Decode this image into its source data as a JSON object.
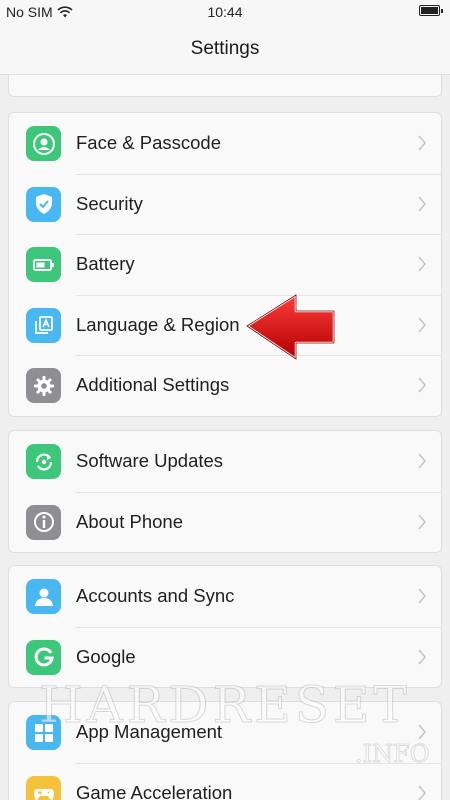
{
  "status_bar": {
    "carrier": "No SIM",
    "time": "10:44"
  },
  "header": {
    "title": "Settings"
  },
  "groups": [
    {
      "items": [
        {
          "label": "Face & Passcode",
          "icon": "face-passcode-icon",
          "color": "#3dc77a"
        },
        {
          "label": "Security",
          "icon": "shield-icon",
          "color": "#4ab8f0"
        },
        {
          "label": "Battery",
          "icon": "battery-icon",
          "color": "#3dc77a"
        },
        {
          "label": "Language & Region",
          "icon": "language-icon",
          "color": "#4ab8f0"
        },
        {
          "label": "Additional Settings",
          "icon": "gear-icon",
          "color": "#8e8e93"
        }
      ]
    },
    {
      "items": [
        {
          "label": "Software Updates",
          "icon": "update-icon",
          "color": "#3dc77a"
        },
        {
          "label": "About Phone",
          "icon": "info-icon",
          "color": "#8e8e93"
        }
      ]
    },
    {
      "items": [
        {
          "label": "Accounts and Sync",
          "icon": "user-icon",
          "color": "#4ab8f0"
        },
        {
          "label": "Google",
          "icon": "google-icon",
          "color": "#3dc77a"
        }
      ]
    },
    {
      "items": [
        {
          "label": "App Management",
          "icon": "apps-grid-icon",
          "color": "#4ab8f0"
        },
        {
          "label": "Game Acceleration",
          "icon": "gamepad-icon",
          "color": "#f5c33b"
        }
      ]
    }
  ],
  "watermark": {
    "text": "HARDRESET",
    "sub": ".INFO"
  },
  "colors": {
    "arrow": "#d91414",
    "accent_green": "#3dc77a",
    "accent_blue": "#4ab8f0"
  }
}
